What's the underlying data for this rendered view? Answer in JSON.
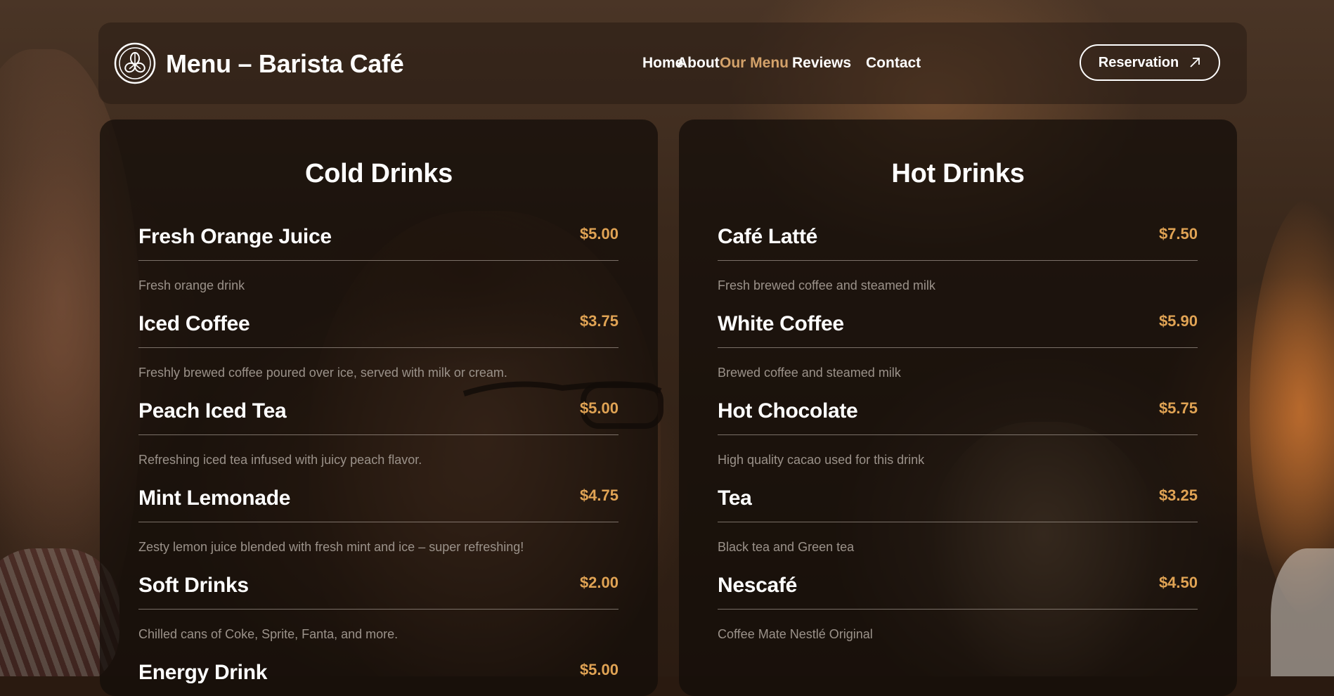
{
  "header": {
    "brand": "Menu – Barista Café",
    "nav": [
      {
        "label": "Home",
        "active": false
      },
      {
        "label": "About",
        "active": false
      },
      {
        "label": "Our Menu",
        "active": true
      },
      {
        "label": "Reviews",
        "active": false
      },
      {
        "label": "Contact",
        "active": false
      }
    ],
    "reservation_label": "Reservation",
    "accent_color": "#d4a26a"
  },
  "menus": {
    "cold": {
      "title": "Cold Drinks",
      "items": [
        {
          "name": "Fresh Orange Juice",
          "price": "$5.00",
          "desc": "Fresh orange drink"
        },
        {
          "name": "Iced Coffee",
          "price": "$3.75",
          "desc": "Freshly brewed coffee poured over ice, served with milk or cream."
        },
        {
          "name": "Peach Iced Tea",
          "price": "$5.00",
          "desc": "Refreshing iced tea infused with juicy peach flavor."
        },
        {
          "name": "Mint Lemonade",
          "price": "$4.75",
          "desc": "Zesty lemon juice blended with fresh mint and ice – super refreshing!"
        },
        {
          "name": "Soft Drinks",
          "price": "$2.00",
          "desc": "Chilled cans of Coke, Sprite, Fanta, and more."
        },
        {
          "name": "Energy Drink",
          "price": "$5.00",
          "desc": ""
        }
      ]
    },
    "hot": {
      "title": "Hot Drinks",
      "items": [
        {
          "name": "Café Latté",
          "price": "$7.50",
          "desc": "Fresh brewed coffee and steamed milk"
        },
        {
          "name": "White Coffee",
          "price": "$5.90",
          "desc": "Brewed coffee and steamed milk"
        },
        {
          "name": "Hot Chocolate",
          "price": "$5.75",
          "desc": "High quality cacao used for this drink"
        },
        {
          "name": "Tea",
          "price": "$3.25",
          "desc": "Black tea and Green tea"
        },
        {
          "name": "Nescafé",
          "price": "$4.50",
          "desc": "Coffee Mate Nestlé Original"
        }
      ]
    }
  },
  "price_color": "#e0a354"
}
